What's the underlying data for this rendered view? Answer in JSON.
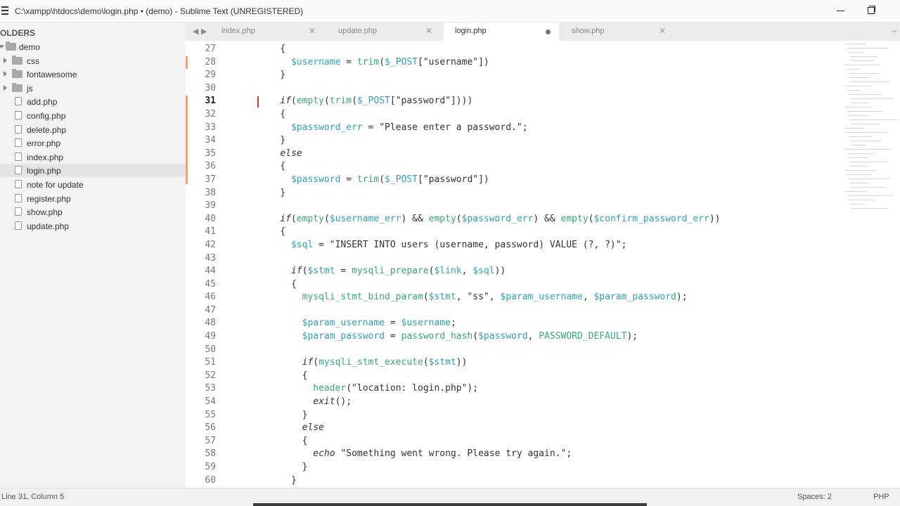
{
  "window": {
    "title": "C:\\xampp\\htdocs\\demo\\login.php • (demo) - Sublime Text (UNREGISTERED)"
  },
  "sidebar": {
    "header": "OLDERS",
    "root": "demo",
    "folders": [
      "css",
      "fontawesome",
      "js"
    ],
    "files": [
      "add.php",
      "config.php",
      "delete.php",
      "error.php",
      "index.php",
      "login.php",
      "note for update",
      "register.php",
      "show.php",
      "update.php"
    ],
    "selected": "login.php"
  },
  "tabs": [
    {
      "label": "index.php"
    },
    {
      "label": "update.php"
    },
    {
      "label": "login.php",
      "active": true,
      "dirty": true
    },
    {
      "label": "show.php"
    }
  ],
  "editor": {
    "current_line": 31,
    "lines": [
      {
        "n": "27",
        "t": "    {"
      },
      {
        "n": "28",
        "t": "      $username = trim($_POST[\"username\"])"
      },
      {
        "n": "29",
        "t": "    }"
      },
      {
        "n": "30",
        "t": ""
      },
      {
        "n": "31",
        "t": "    if(empty(trim($_POST[\"password\"])))"
      },
      {
        "n": "32",
        "t": "    {"
      },
      {
        "n": "33",
        "t": "      $password_err = \"Please enter a password.\";"
      },
      {
        "n": "34",
        "t": "    }"
      },
      {
        "n": "35",
        "t": "    else"
      },
      {
        "n": "36",
        "t": "    {"
      },
      {
        "n": "37",
        "t": "      $password = trim($_POST[\"password\"])"
      },
      {
        "n": "38",
        "t": "    }"
      },
      {
        "n": "39",
        "t": ""
      },
      {
        "n": "40",
        "t": "    if(empty($username_err) && empty($password_err) && empty($confirm_password_err))"
      },
      {
        "n": "41",
        "t": "    {"
      },
      {
        "n": "42",
        "t": "      $sql = \"INSERT INTO users (username, password) VALUE (?, ?)\";"
      },
      {
        "n": "43",
        "t": ""
      },
      {
        "n": "44",
        "t": "      if($stmt = mysqli_prepare($link, $sql))"
      },
      {
        "n": "45",
        "t": "      {"
      },
      {
        "n": "46",
        "t": "        mysqli_stmt_bind_param($stmt, \"ss\", $param_username, $param_password);"
      },
      {
        "n": "47",
        "t": ""
      },
      {
        "n": "48",
        "t": "        $param_username = $username;"
      },
      {
        "n": "49",
        "t": "        $param_password = password_hash($password, PASSWORD_DEFAULT);"
      },
      {
        "n": "50",
        "t": ""
      },
      {
        "n": "51",
        "t": "        if(mysqli_stmt_execute($stmt))"
      },
      {
        "n": "52",
        "t": "        {"
      },
      {
        "n": "53",
        "t": "          header(\"location: login.php\");"
      },
      {
        "n": "54",
        "t": "          exit();"
      },
      {
        "n": "55",
        "t": "        }"
      },
      {
        "n": "56",
        "t": "        else"
      },
      {
        "n": "57",
        "t": "        {"
      },
      {
        "n": "58",
        "t": "          echo \"Something went wrong. Please try again.\";"
      },
      {
        "n": "59",
        "t": "        }"
      },
      {
        "n": "60",
        "t": "      }"
      }
    ]
  },
  "status": {
    "position": "Line 31, Column 5",
    "spaces": "Spaces: 2",
    "syntax": "PHP"
  },
  "colors": {
    "variable": "#2f9fb0",
    "function": "#3aa37a",
    "string": "#333333",
    "keyword": "#333333",
    "gutter_modified": "#f0a36b",
    "caret": "#c0392b"
  }
}
